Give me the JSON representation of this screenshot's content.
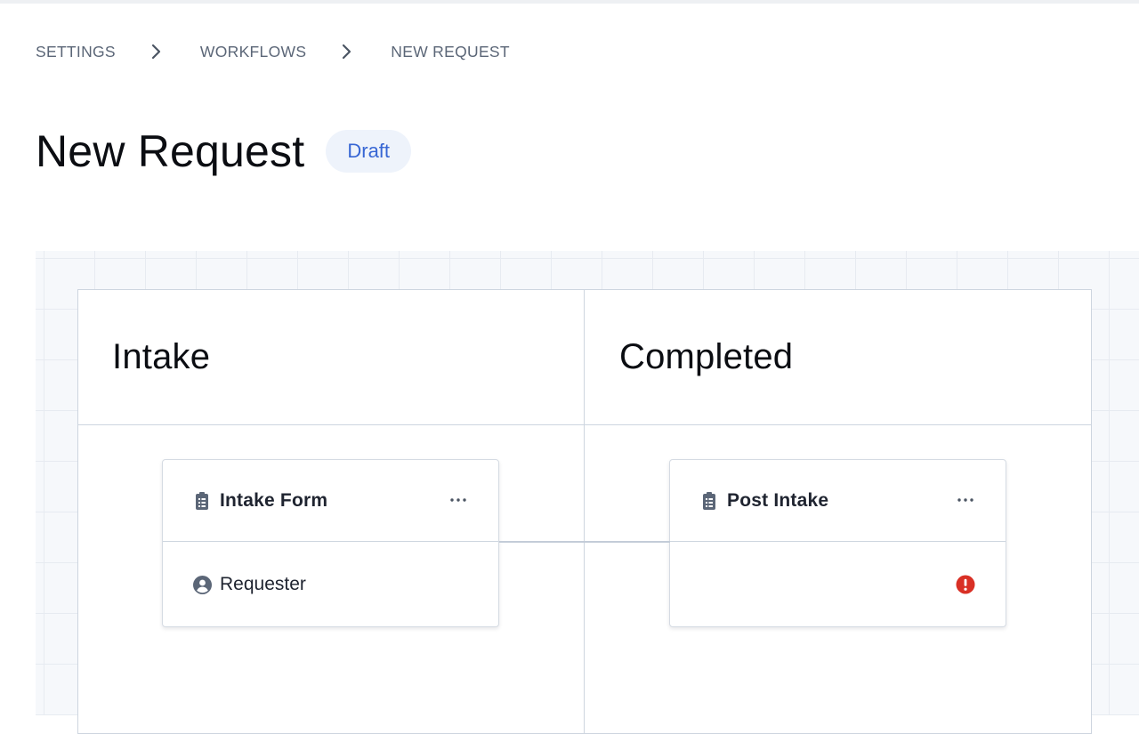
{
  "breadcrumb": {
    "items": [
      "SETTINGS",
      "WORKFLOWS",
      "NEW REQUEST"
    ]
  },
  "page": {
    "title": "New Request",
    "status_badge": "Draft"
  },
  "board": {
    "columns": [
      {
        "title": "Intake",
        "card": {
          "title": "Intake Form",
          "icon": "clipboard-icon",
          "row_label": "Requester",
          "row_icon": "user-circle-icon"
        }
      },
      {
        "title": "Completed",
        "card": {
          "title": "Post Intake",
          "icon": "clipboard-icon",
          "row_label": "",
          "row_icon": "alert-icon"
        }
      }
    ]
  },
  "colors": {
    "accent": "#3766d4",
    "badge_bg": "#eef3fb",
    "alert": "#d93025",
    "border": "#cdd5df",
    "muted_text": "#5b6677"
  }
}
